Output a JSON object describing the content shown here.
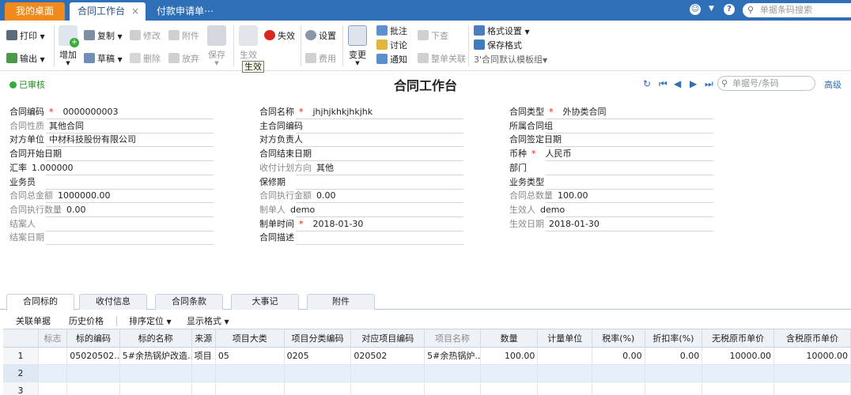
{
  "top": {
    "tabs": [
      {
        "label": "我的桌面"
      },
      {
        "label": "合同工作台",
        "close": "×"
      },
      {
        "label": "付款申请单⋯"
      }
    ],
    "search_placeholder": "单据条码搜索"
  },
  "toolbar": {
    "print": "打印",
    "export": "输出",
    "add": "增加",
    "copy": "复制",
    "draft": "草稿",
    "modify": "修改",
    "delete": "删除",
    "attachment": "附件",
    "abandon": "放弃",
    "save": "保存",
    "effective": "生效",
    "invalid": "失效",
    "settings": "设置",
    "fee": "费用",
    "change": "变更",
    "approve": "批注",
    "discuss": "讨论",
    "notify": "通知",
    "push_down": "下查",
    "whole_link": "整单关联",
    "format_settings": "格式设置",
    "save_format": "保存格式",
    "template_select": "3'合同默认模板组",
    "tooltip": "生效"
  },
  "header": {
    "status": "已审核",
    "title": "合同工作台",
    "doc_search_placeholder": "单据号/条码",
    "advanced": "高级"
  },
  "form": {
    "col1": [
      {
        "label": "合同编码",
        "required": "*",
        "value": "0000000003",
        "gray": false
      },
      {
        "label": "合同性质",
        "value": "其他合同",
        "gray": true
      },
      {
        "label": "对方单位",
        "value": "中材科技股份有限公司",
        "gray": false
      },
      {
        "label": "合同开始日期",
        "value": "",
        "gray": false
      },
      {
        "label": "汇率",
        "value": "1.000000",
        "gray": false
      },
      {
        "label": "业务员",
        "value": "",
        "gray": false
      },
      {
        "label": "合同总金额",
        "value": "1000000.00",
        "gray": true
      },
      {
        "label": "合同执行数量",
        "value": "0.00",
        "gray": true
      },
      {
        "label": "结案人",
        "value": "",
        "gray": true
      },
      {
        "label": "结案日期",
        "value": "",
        "gray": true
      }
    ],
    "col2": [
      {
        "label": "合同名称",
        "required": "*",
        "value": "jhjhjkhkjhkjhk",
        "gray": false
      },
      {
        "label": "主合同编码",
        "value": "",
        "gray": false
      },
      {
        "label": "对方负责人",
        "value": "",
        "gray": false
      },
      {
        "label": "合同结束日期",
        "value": "",
        "gray": false
      },
      {
        "label": "收付计划方向",
        "value": "其他",
        "gray": true
      },
      {
        "label": "保修期",
        "value": "",
        "gray": false
      },
      {
        "label": "合同执行金额",
        "value": "0.00",
        "gray": true
      },
      {
        "label": "制单人",
        "value": "demo",
        "gray": true
      },
      {
        "label": "制单时间",
        "required": "*",
        "value": "2018-01-30",
        "gray": false
      },
      {
        "label": "合同描述",
        "value": "",
        "gray": false
      }
    ],
    "col3": [
      {
        "label": "合同类型",
        "required": "*",
        "value": "外协类合同",
        "gray": false
      },
      {
        "label": "所属合同组",
        "value": "",
        "gray": false
      },
      {
        "label": "合同签定日期",
        "value": "",
        "gray": false
      },
      {
        "label": "币种",
        "required": "*",
        "value": "人民币",
        "gray": false
      },
      {
        "label": "部门",
        "value": "",
        "gray": false
      },
      {
        "label": "业务类型",
        "value": "",
        "gray": false
      },
      {
        "label": "合同总数量",
        "value": "100.00",
        "gray": true
      },
      {
        "label": "生效人",
        "value": "demo",
        "gray": true
      },
      {
        "label": "生效日期",
        "value": "2018-01-30",
        "gray": true
      }
    ]
  },
  "bottom_tabs": [
    "合同标的",
    "收付信息",
    "合同条款",
    "大事记",
    "附件"
  ],
  "subbar": {
    "link_doc": "关联单据",
    "history_price": "历史价格",
    "sort_locate": "排序定位",
    "display_format": "显示格式"
  },
  "grid": {
    "columns": [
      "标志",
      "标的编码",
      "标的名称",
      "来源",
      "项目大类",
      "项目分类编码",
      "对应项目编码",
      "项目名称",
      "数量",
      "计量单位",
      "税率(%)",
      "折扣率(%)",
      "无税原币单价",
      "含税原币单价"
    ],
    "gray_columns": [
      0,
      7
    ],
    "rows": [
      {
        "n": "1",
        "cells": [
          "",
          "05020502...",
          "5#余热锅炉改造...",
          "项目",
          "05",
          "0205",
          "020502",
          "5#余热锅炉...",
          "100.00",
          "",
          "0.00",
          "0.00",
          "10000.00",
          "10000.00"
        ]
      },
      {
        "n": "2",
        "cells": [
          "",
          "",
          "",
          "",
          "",
          "",
          "",
          "",
          "",
          "",
          "",
          "",
          "",
          ""
        ]
      },
      {
        "n": "3",
        "cells": [
          "",
          "",
          "",
          "",
          "",
          "",
          "",
          "",
          "",
          "",
          "",
          "",
          "",
          ""
        ]
      }
    ]
  }
}
